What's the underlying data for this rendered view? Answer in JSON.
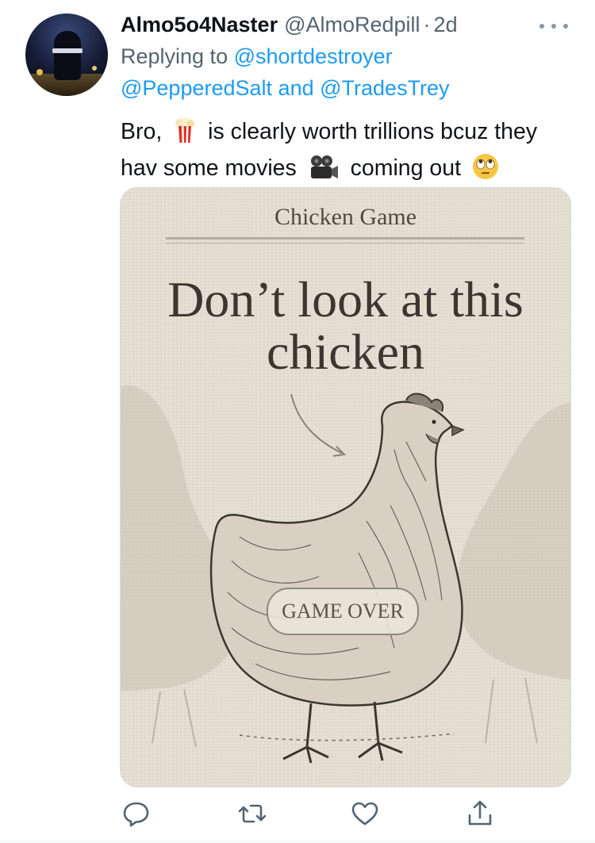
{
  "tweet": {
    "display_name": "Almo5o4Naster",
    "handle": "@AlmoRedpill",
    "separator": "·",
    "time": "2d",
    "replying_to_label": "Replying to",
    "mentions": [
      "@shortdestroyer",
      "@PepperedSalt",
      "@TradesTrey"
    ],
    "and_word": "and",
    "text_parts": [
      "Bro,",
      "is clearly worth trillions bcuz they hav some movies",
      "coming out"
    ],
    "emojis": [
      "popcorn-icon",
      "movie-camera-icon",
      "face-with-rolling-eyes-icon"
    ]
  },
  "media": {
    "title": "Chicken Game",
    "headline_line1": "Don’t look at this",
    "headline_line2": "chicken",
    "badge": "GAME OVER"
  },
  "actions": [
    "reply-icon",
    "retweet-icon",
    "like-icon",
    "share-icon"
  ],
  "colors": {
    "link": "#1d9bf0",
    "secondary_text": "#536471",
    "primary_text": "#0f1419",
    "icon": "#536471"
  }
}
